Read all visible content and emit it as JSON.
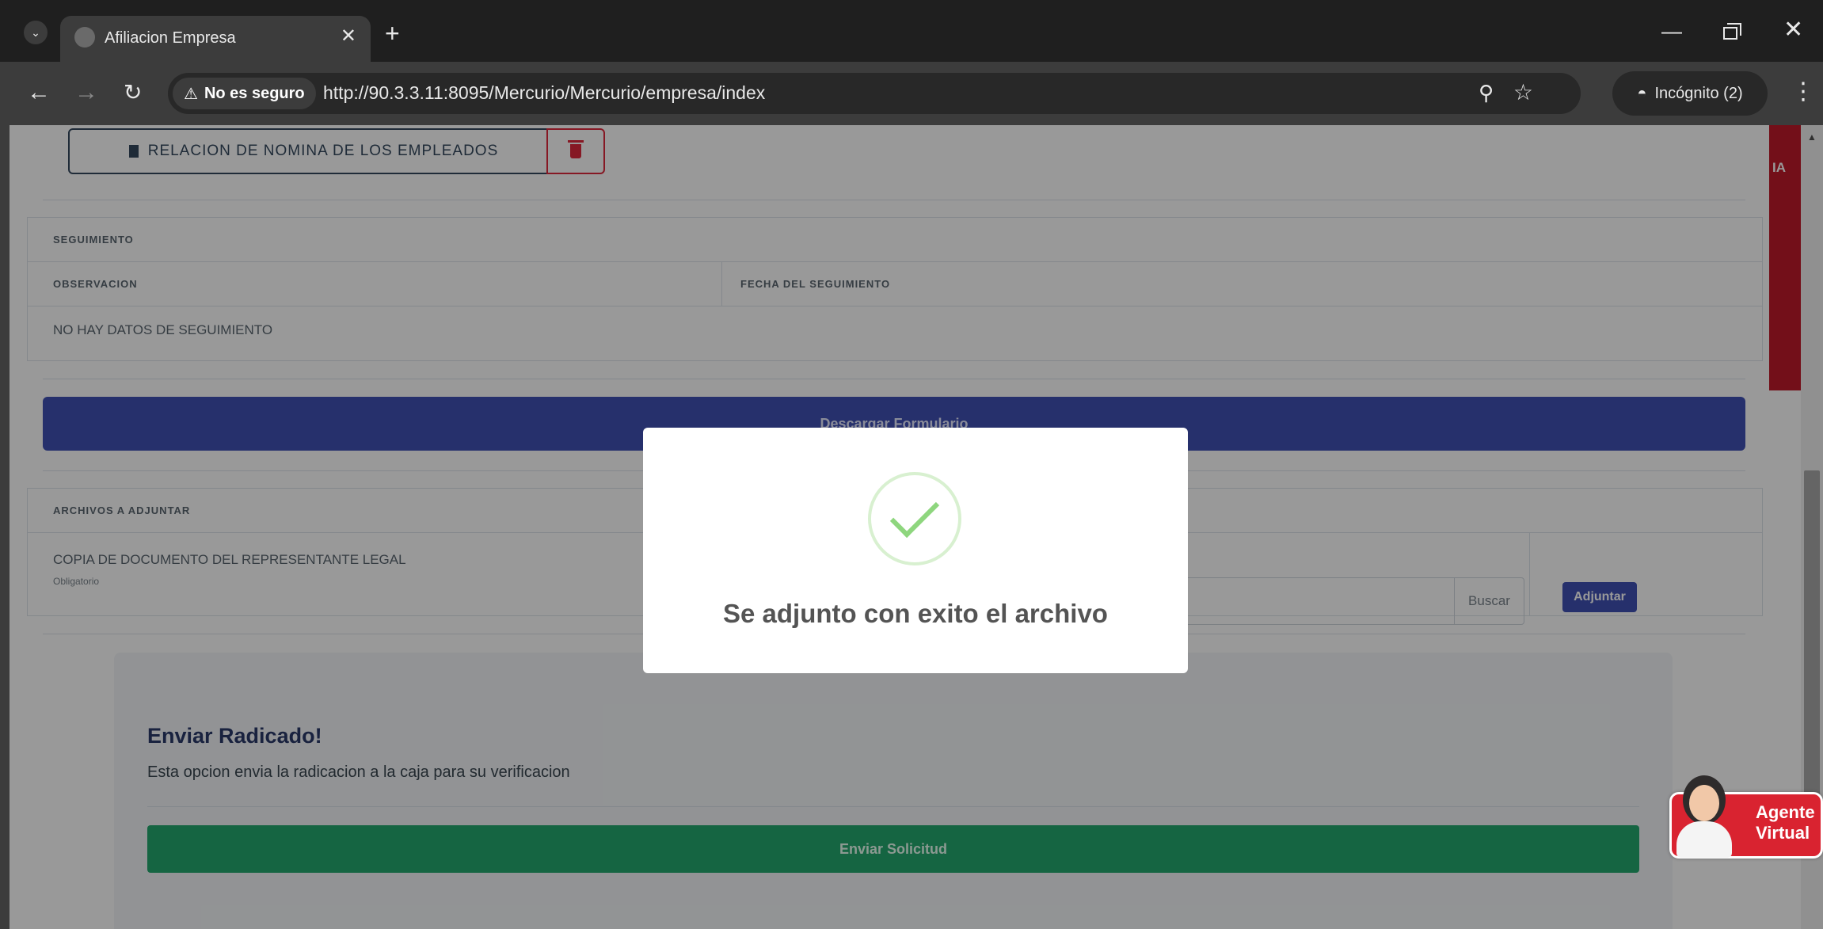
{
  "browser": {
    "tab_title": "Afiliacion Empresa",
    "security_label": "No es seguro",
    "url": "http://90.3.3.11:8095/Mercurio/Mercurio/empresa/index",
    "incognito_label": "Incógnito (2)"
  },
  "page": {
    "file_button_label": "RELACION DE NOMINA DE LOS EMPLEADOS",
    "seguimiento": {
      "header": "SEGUIMIENTO",
      "col_observacion": "OBSERVACION",
      "col_fecha": "FECHA DEL SEGUIMIENTO",
      "empty_text": "NO HAY DATOS DE SEGUIMIENTO"
    },
    "download_button_label": "Descargar Formulario",
    "archivos": {
      "header": "ARCHIVOS A ADJUNTAR",
      "doc_label": "COPIA DE DOCUMENTO DEL REPRESENTANTE LEGAL",
      "doc_required": "Obligatorio",
      "browse_label": "Buscar",
      "attach_label": "Adjuntar"
    },
    "enviar": {
      "title": "Enviar Radicado!",
      "description": "Esta opcion envia la radicacion a la caja para su verificacion",
      "button_label": "Enviar Solicitud"
    },
    "side_strip_text": "IA"
  },
  "modal": {
    "message": "Se adjunto con exito el archivo"
  },
  "agent": {
    "label": "Agente Virtual"
  },
  "colors": {
    "primary_blue": "#4051b5",
    "success_green": "#23a86e",
    "danger_red": "#e0293c",
    "agent_red": "#d92330"
  }
}
